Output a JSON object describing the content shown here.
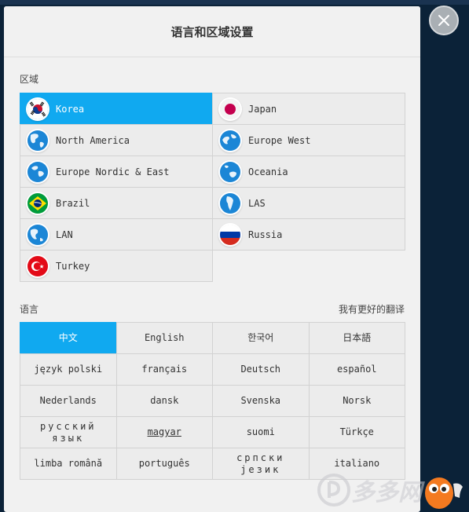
{
  "dialog": {
    "title": "语言和区域设置"
  },
  "region_section": {
    "label": "区域",
    "items": [
      {
        "label": "Korea",
        "flag": "korea-flag-icon",
        "selected": true
      },
      {
        "label": "Japan",
        "flag": "japan-flag-icon",
        "selected": false
      },
      {
        "label": "North America",
        "flag": "globe-icon",
        "selected": false
      },
      {
        "label": "Europe West",
        "flag": "globe-icon",
        "selected": false
      },
      {
        "label": "Europe Nordic & East",
        "flag": "globe-icon",
        "selected": false
      },
      {
        "label": "Oceania",
        "flag": "globe-icon",
        "selected": false
      },
      {
        "label": "Brazil",
        "flag": "brazil-flag-icon",
        "selected": false
      },
      {
        "label": "LAS",
        "flag": "globe-icon",
        "selected": false
      },
      {
        "label": "LAN",
        "flag": "globe-icon",
        "selected": false
      },
      {
        "label": "Russia",
        "flag": "russia-flag-icon",
        "selected": false
      },
      {
        "label": "Turkey",
        "flag": "turkey-flag-icon",
        "selected": false
      }
    ]
  },
  "language_section": {
    "label": "语言",
    "translate_link": "我有更好的翻译",
    "items": [
      {
        "label": "中文",
        "selected": true
      },
      {
        "label": "English"
      },
      {
        "label": "한국어"
      },
      {
        "label": "日本語"
      },
      {
        "label": "język polski"
      },
      {
        "label": "français"
      },
      {
        "label": "Deutsch"
      },
      {
        "label": "español"
      },
      {
        "label": "Nederlands"
      },
      {
        "label": "dansk"
      },
      {
        "label": "Svenska"
      },
      {
        "label": "Norsk"
      },
      {
        "label": "русский язык"
      },
      {
        "label": "magyar"
      },
      {
        "label": "suomi"
      },
      {
        "label": "Türkçe"
      },
      {
        "label": "limba română"
      },
      {
        "label": "português"
      },
      {
        "label": "српски језик"
      },
      {
        "label": "italiano"
      }
    ]
  },
  "watermark": {
    "text": "多多网"
  },
  "colors": {
    "accent": "#10a9f0",
    "backdrop": "#0b2238",
    "panel": "#f1f1f1"
  }
}
